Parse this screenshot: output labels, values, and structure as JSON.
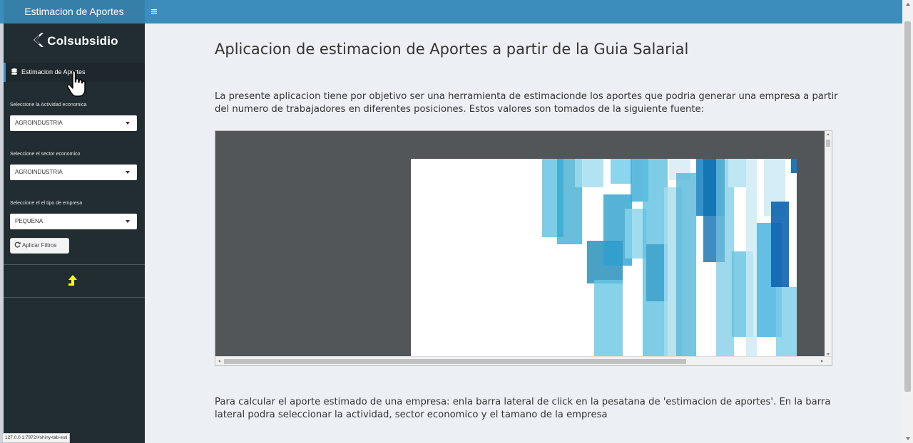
{
  "header": {
    "title": "Estimacion de Aportes",
    "toggle_icon": "hamburger-icon"
  },
  "sidebar": {
    "logo_text": "Colsubsidio",
    "menu_item": {
      "label": "Estimacion de Aportes",
      "icon": "database-icon"
    },
    "filters": [
      {
        "label": "Seleccione la Actividad economica",
        "value": "AGROINDUSTRIA"
      },
      {
        "label": "Seleccione el sector economico",
        "value": "AGROINDUSTRIA"
      },
      {
        "label": "Seleccione el el tipo de empresa",
        "value": "PEQUENA"
      }
    ],
    "apply_button": {
      "label": "Aplicar Filtros",
      "icon": "refresh-icon"
    },
    "scroll_top_icon": "arrow-up-icon",
    "accent_icon_color": "#ffff00"
  },
  "status_url": "127.0.0.1:7972/#shiny-tab-esti",
  "main": {
    "title": "Aplicacion de estimacion de Aportes a partir de la Guia Salarial",
    "intro": "La presente aplicacion tiene por objetivo ser una herramienta de estimacionde los aportes que podria generar una empresa a partir del numero de trabajadores en diferentes posiciones. Estos valores son tomados de la siguiente fuente:",
    "outro": "Para calcular el aporte estimado de una empresa: enla barra lateral de click en la pesatana de 'estimacion de aportes'. En la barra lateral podra seleccionar la actividad, sector economico y el tamano de la empresa"
  },
  "colors": {
    "topbar": "#3c8dbc",
    "sidebar": "#222d32",
    "content_bg": "#ecf0f5",
    "viewer_bg": "#525659"
  }
}
